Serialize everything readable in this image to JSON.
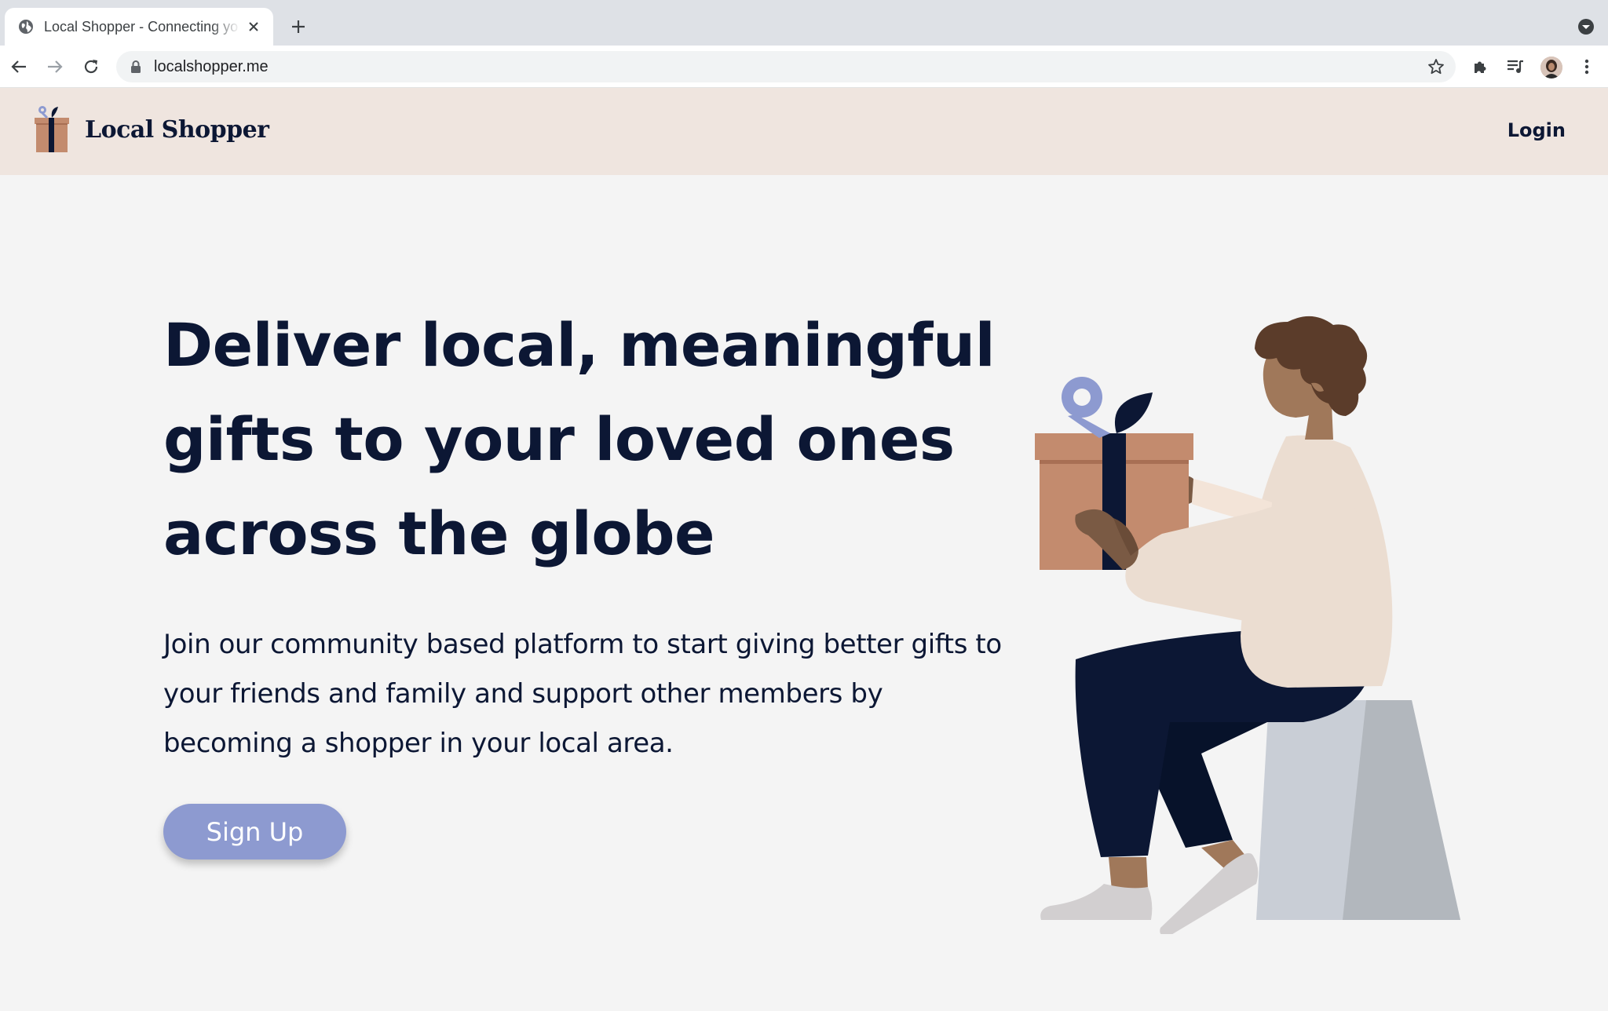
{
  "browser": {
    "tab_title": "Local Shopper - Connecting yo",
    "url": "localshopper.me",
    "icons": [
      "globe-icon",
      "close-icon",
      "plus-icon",
      "tab-search-icon",
      "back-arrow-icon",
      "forward-arrow-icon",
      "reload-icon",
      "lock-icon",
      "star-icon",
      "extensions-icon",
      "media-queue-icon",
      "avatar",
      "more-vert-icon"
    ]
  },
  "header": {
    "brand": "Local Shopper",
    "login_label": "Login"
  },
  "hero": {
    "title": "Deliver local, meaningful gifts to your loved ones across the globe",
    "subtitle": "Join our community based platform to start giving better gifts to your friends and family and support other members by becoming a shopper in your local area.",
    "signup_label": "Sign Up"
  },
  "colors": {
    "navy": "#0c1734",
    "header_bg": "#efe5df",
    "page_bg": "#f4f4f4",
    "accent": "#8d9ad0",
    "gift_box": "#c38b6e"
  }
}
